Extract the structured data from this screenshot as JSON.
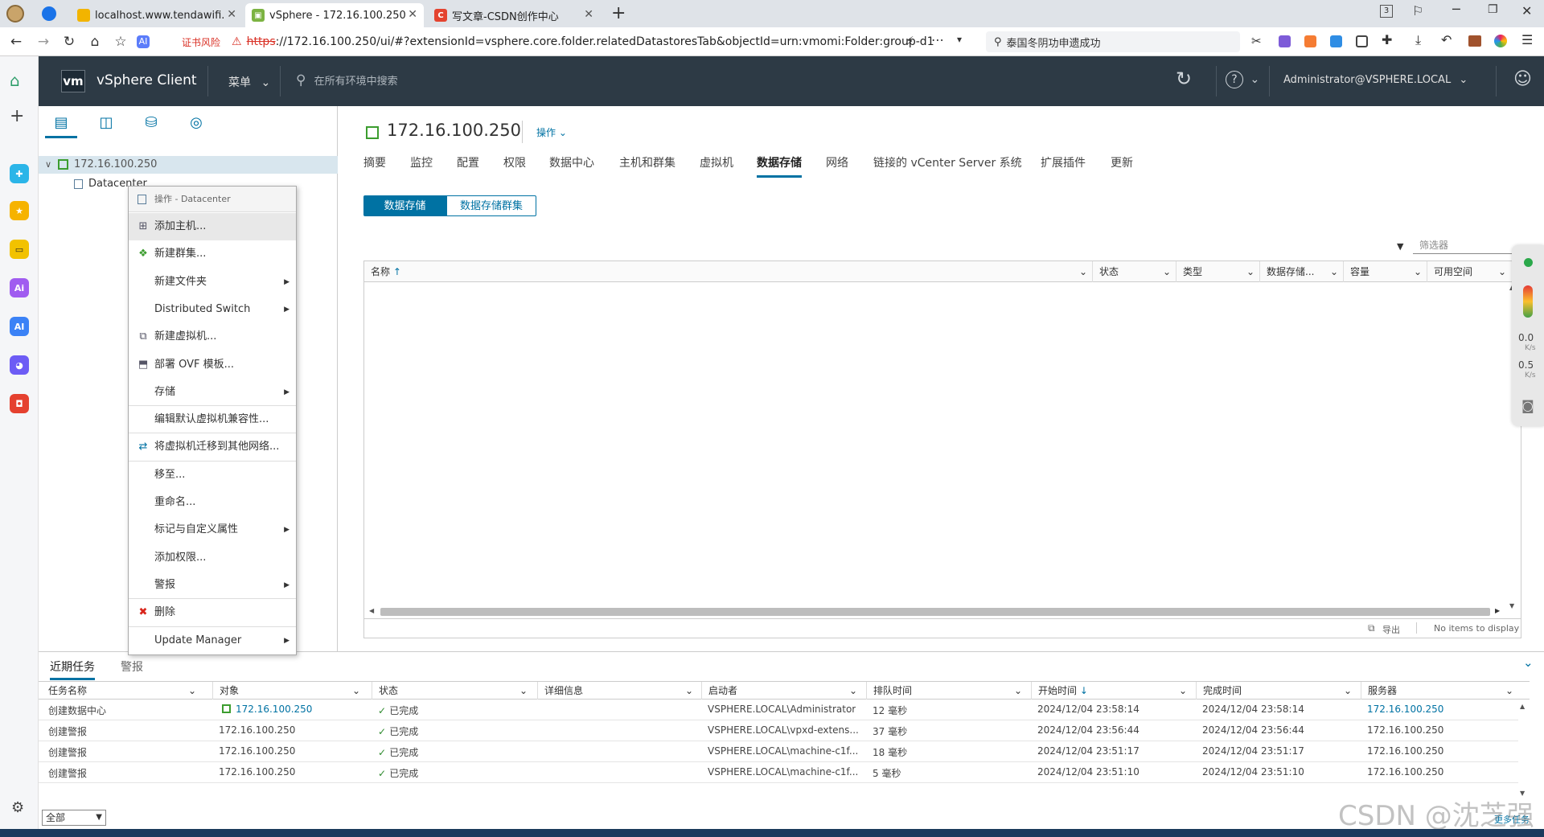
{
  "browser": {
    "tabs": [
      {
        "label": "localhost.www.tendawifi.com",
        "favicon": "tenda-icon"
      },
      {
        "label": "vSphere - 172.16.100.250 -",
        "favicon": "vsphere-icon"
      },
      {
        "label": "写文章-CSDN创作中心",
        "favicon": "csdn-icon"
      }
    ],
    "new_tab": "+",
    "cert_warning": "证书风险",
    "url_scheme": "https",
    "url_rest": "://172.16.100.250/ui/#?extensionId=vsphere.core.folder.relatedDatastoresTab&objectId=urn:vmomi:Folder:group-d1",
    "search_text": "泰国冬阴功申遗成功",
    "tab_count": "3"
  },
  "vsphere": {
    "logo": "vm",
    "app_title": "vSphere Client",
    "menu_label": "菜单",
    "search_placeholder": "在所有环境中搜索",
    "user": "Administrator@VSPHERE.LOCAL"
  },
  "tree": {
    "root": "172.16.100.250",
    "child": "Datacenter"
  },
  "main": {
    "title": "172.16.100.250",
    "actions": "操作",
    "tabs": [
      "摘要",
      "监控",
      "配置",
      "权限",
      "数据中心",
      "主机和群集",
      "虚拟机",
      "数据存储",
      "网络",
      "链接的 vCenter Server 系统",
      "扩展插件",
      "更新"
    ],
    "active_tab": "数据存储",
    "subtabs": [
      "数据存储",
      "数据存储群集"
    ],
    "filter_placeholder": "筛选器",
    "columns": [
      "名称",
      "状态",
      "类型",
      "数据存储...",
      "容量",
      "可用空间"
    ],
    "sort_arrow": "↑",
    "export": "导出",
    "empty": "No items to display"
  },
  "context_menu": {
    "header": "操作 - Datacenter",
    "items": [
      {
        "label": "添加主机...",
        "icon": "add-host-icon",
        "submenu": false
      },
      {
        "label": "新建群集...",
        "icon": "cluster-icon",
        "submenu": false
      },
      {
        "label": "新建文件夹",
        "icon": "",
        "submenu": true
      },
      {
        "label": "Distributed Switch",
        "icon": "",
        "submenu": true
      },
      {
        "label": "新建虚拟机...",
        "icon": "new-vm-icon",
        "submenu": false
      },
      {
        "label": "部署 OVF 模板...",
        "icon": "ovf-icon",
        "submenu": false
      },
      {
        "label": "存储",
        "icon": "",
        "submenu": true
      },
      {
        "label": "编辑默认虚拟机兼容性...",
        "icon": "",
        "submenu": false
      },
      {
        "label": "将虚拟机迁移到其他网络...",
        "icon": "migrate-icon",
        "submenu": false
      },
      {
        "label": "移至...",
        "icon": "",
        "submenu": false
      },
      {
        "label": "重命名...",
        "icon": "",
        "submenu": false
      },
      {
        "label": "标记与自定义属性",
        "icon": "",
        "submenu": true
      },
      {
        "label": "添加权限...",
        "icon": "",
        "submenu": false
      },
      {
        "label": "警报",
        "icon": "",
        "submenu": true
      },
      {
        "label": "删除",
        "icon": "delete-icon",
        "submenu": false
      },
      {
        "label": "Update Manager",
        "icon": "",
        "submenu": true
      }
    ]
  },
  "tasks": {
    "tabs": [
      "近期任务",
      "警报"
    ],
    "columns": [
      "任务名称",
      "对象",
      "状态",
      "详细信息",
      "启动者",
      "排队时间",
      "开始时间",
      "完成时间",
      "服务器"
    ],
    "sort_arrow": "↓",
    "rows": [
      [
        "创建数据中心",
        "172.16.100.250",
        "已完成",
        "",
        "VSPHERE.LOCAL\\Administrator",
        "12 毫秒",
        "2024/12/04 23:58:14",
        "2024/12/04 23:58:14",
        "172.16.100.250"
      ],
      [
        "创建警报",
        "172.16.100.250",
        "已完成",
        "",
        "VSPHERE.LOCAL\\vpxd-extens...",
        "37 毫秒",
        "2024/12/04 23:56:44",
        "2024/12/04 23:56:44",
        "172.16.100.250"
      ],
      [
        "创建警报",
        "172.16.100.250",
        "已完成",
        "",
        "VSPHERE.LOCAL\\machine-c1f...",
        "18 毫秒",
        "2024/12/04 23:51:17",
        "2024/12/04 23:51:17",
        "172.16.100.250"
      ],
      [
        "创建警报",
        "172.16.100.250",
        "已完成",
        "",
        "VSPHERE.LOCAL\\machine-c1f...",
        "5 毫秒",
        "2024/12/04 23:51:10",
        "2024/12/04 23:51:10",
        "172.16.100.250"
      ]
    ],
    "filter_select": "全部",
    "more_tasks": "更多任务"
  },
  "net_widget": {
    "up": "0.0",
    "down": "0.5",
    "unit": "K/s"
  },
  "watermark": "CSDN @沈芝强",
  "colors": {
    "header_bg": "#2d3a45",
    "accent": "#0072a3",
    "link": "#0072a3",
    "ok_green": "#2e8b2e",
    "delete_red": "#d9261c"
  }
}
